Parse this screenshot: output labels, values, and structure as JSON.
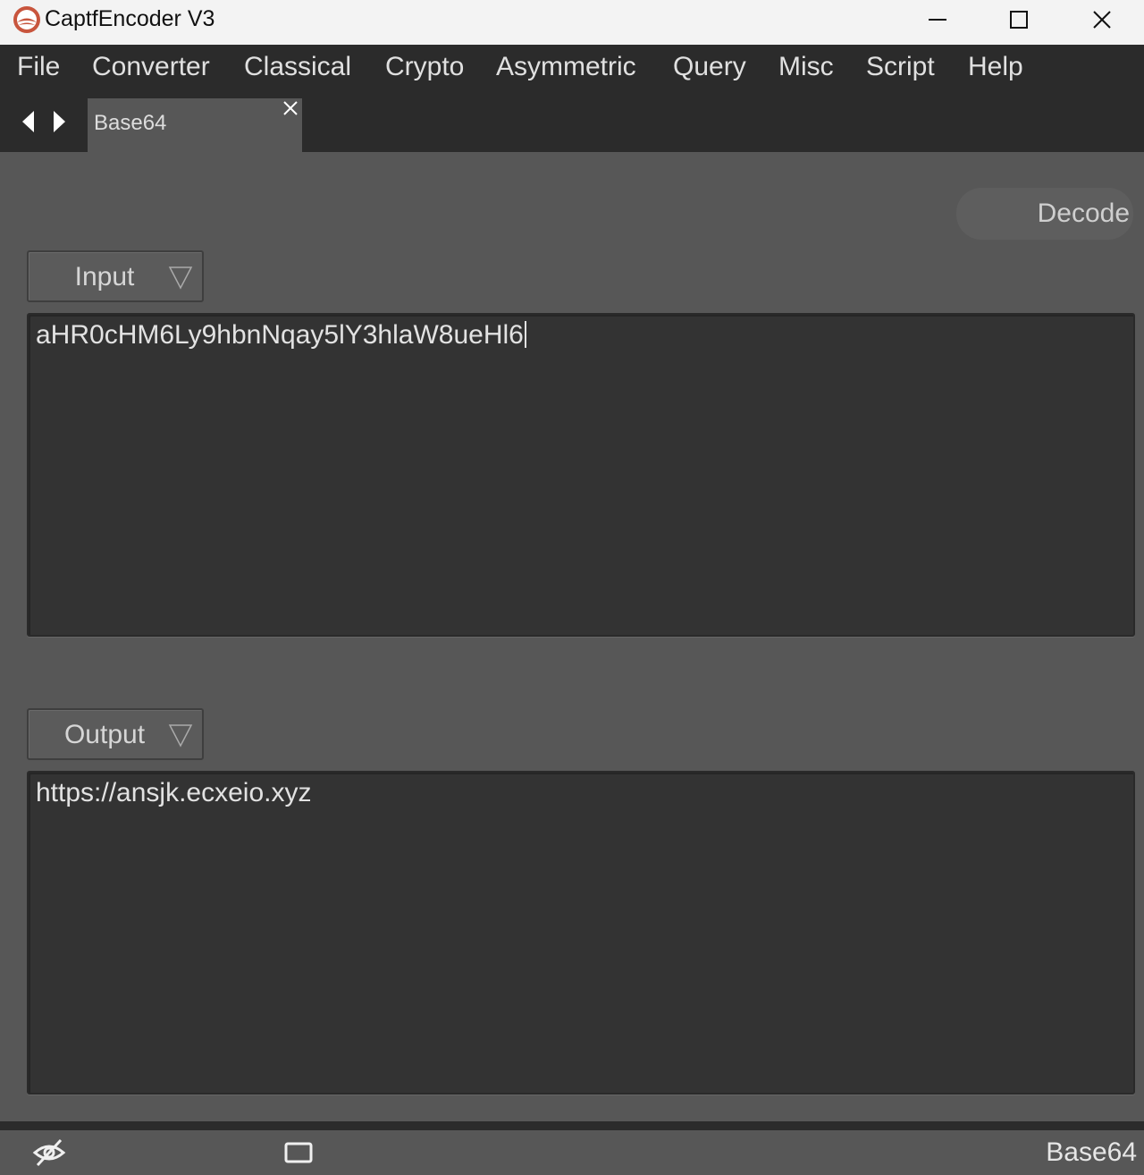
{
  "window": {
    "title": "CaptfEncoder V3",
    "controls": [
      "minimize-icon",
      "maximize-icon",
      "close-icon"
    ]
  },
  "menu": {
    "items": [
      "File",
      "Converter",
      "Classical",
      "Crypto",
      "Asymmetric",
      "Query",
      "Misc",
      "Script",
      "Help"
    ]
  },
  "tabs": {
    "items": [
      {
        "label": "Base64",
        "active": true
      }
    ]
  },
  "toolbar": {
    "action_label": "Decode"
  },
  "input": {
    "format_label": "Input",
    "value": "aHR0cHM6Ly9hbnNqay5lY3hlaW8ueHl6"
  },
  "output": {
    "format_label": "Output",
    "value": "https://ansjk.ecxeio.xyz"
  },
  "status": {
    "current_tool": "Base64",
    "icons": [
      "eye-off-icon",
      "window-icon"
    ]
  },
  "colors": {
    "background_dark": "#2b2b2b",
    "panel": "#575757",
    "textarea": "#333333",
    "logo_accent": "#c8553d"
  }
}
